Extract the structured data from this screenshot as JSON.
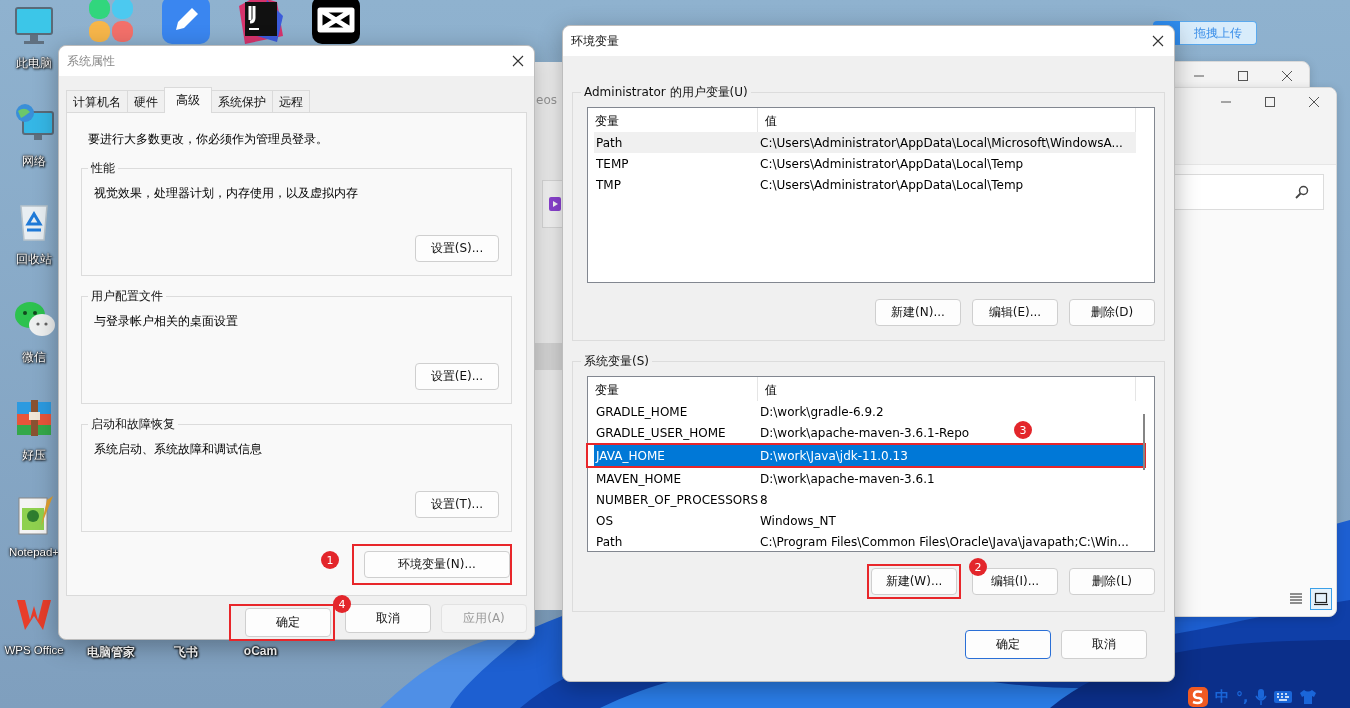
{
  "desktop": {
    "left_icons": [
      {
        "kind": "monitor",
        "label": "此电脑"
      },
      {
        "kind": "network",
        "label": "网络"
      },
      {
        "kind": "recycle",
        "label": "回收站"
      },
      {
        "kind": "chat",
        "label": "微信"
      },
      {
        "kind": "archive",
        "label": "好压"
      },
      {
        "kind": "notepad",
        "label": "Notepad+"
      },
      {
        "kind": "office",
        "label": "WPS Office"
      }
    ],
    "top_icons": [
      {
        "kind": "petals"
      },
      {
        "kind": "pencil"
      },
      {
        "kind": "ide"
      },
      {
        "kind": "clapper"
      }
    ],
    "bottom_labels": [
      "电脑管家",
      "飞书",
      "oCam"
    ]
  },
  "upload_button": "拖拽上传",
  "background_window": {
    "text": "eos"
  },
  "system_properties": {
    "title": "系统属性",
    "tabs": [
      {
        "label": "计算机名",
        "selected": false
      },
      {
        "label": "硬件",
        "selected": false
      },
      {
        "label": "高级",
        "selected": true
      },
      {
        "label": "系统保护",
        "selected": false
      },
      {
        "label": "远程",
        "selected": false
      }
    ],
    "note": "要进行大多数更改，你必须作为管理员登录。",
    "groups": [
      {
        "title": "性能",
        "description": "视觉效果，处理器计划，内存使用，以及虚拟内存",
        "button": "设置(S)..."
      },
      {
        "title": "用户配置文件",
        "description": "与登录帐户相关的桌面设置",
        "button": "设置(E)..."
      },
      {
        "title": "启动和故障恢复",
        "description": "系统启动、系统故障和调试信息",
        "button": "设置(T)..."
      }
    ],
    "env_button": {
      "label": "环境变量(N)...",
      "step": "1"
    },
    "buttons": [
      {
        "label": "确定",
        "disabled": false,
        "step": "4"
      },
      {
        "label": "取消",
        "disabled": false
      },
      {
        "label": "应用(A)",
        "disabled": true
      }
    ]
  },
  "environment_variables": {
    "title": "环境变量",
    "user_group": {
      "title": "Administrator 的用户变量(U)",
      "columns": [
        "变量",
        "值"
      ],
      "rows": [
        {
          "name": "Path",
          "value": "C:\\Users\\Administrator\\AppData\\Local\\Microsoft\\WindowsA...",
          "selected": false,
          "hovered": true
        },
        {
          "name": "TEMP",
          "value": "C:\\Users\\Administrator\\AppData\\Local\\Temp",
          "selected": false,
          "hovered": false
        },
        {
          "name": "TMP",
          "value": "C:\\Users\\Administrator\\AppData\\Local\\Temp",
          "selected": false,
          "hovered": false
        }
      ],
      "buttons": [
        {
          "label": "新建(N)..."
        },
        {
          "label": "编辑(E)..."
        },
        {
          "label": "删除(D)"
        }
      ]
    },
    "system_group": {
      "title": "系统变量(S)",
      "columns": [
        "变量",
        "值"
      ],
      "rows": [
        {
          "name": "GRADLE_HOME",
          "value": "D:\\work\\gradle-6.9.2",
          "selected": false,
          "hovered": false
        },
        {
          "name": "GRADLE_USER_HOME",
          "value": "D:\\work\\apache-maven-3.6.1-Repo",
          "selected": false,
          "hovered": false
        },
        {
          "name": "JAVA_HOME",
          "value": "D:\\work\\Java\\jdk-11.0.13",
          "selected": true,
          "hovered": false,
          "step": "3"
        },
        {
          "name": "MAVEN_HOME",
          "value": "D:\\work\\apache-maven-3.6.1",
          "selected": false,
          "hovered": false
        },
        {
          "name": "NUMBER_OF_PROCESSORS",
          "value": "8",
          "selected": false,
          "hovered": false
        },
        {
          "name": "OS",
          "value": "Windows_NT",
          "selected": false,
          "hovered": false
        },
        {
          "name": "Path",
          "value": "C:\\Program Files\\Common Files\\Oracle\\Java\\javapath;C:\\Win...",
          "selected": false,
          "hovered": false
        }
      ],
      "buttons": [
        {
          "label": "新建(W)...",
          "step": "2"
        },
        {
          "label": "编辑(I)..."
        },
        {
          "label": "删除(L)"
        }
      ]
    },
    "buttons": [
      {
        "label": "确定",
        "default": true
      },
      {
        "label": "取消",
        "default": false
      }
    ]
  },
  "tray": {
    "ime_mode": "中",
    "punctuation": "°,"
  }
}
